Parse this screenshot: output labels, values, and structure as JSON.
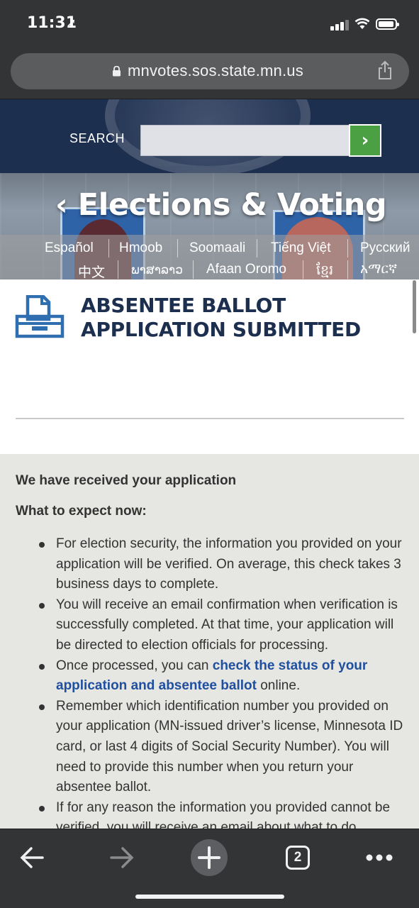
{
  "status_bar": {
    "time": "11:31",
    "location_glyph": "➚"
  },
  "browser": {
    "url": "mnvotes.sos.state.mn.us"
  },
  "header": {
    "search_label": "SEARCH",
    "search_placeholder": "",
    "search_go": "›"
  },
  "hero": {
    "title": "Elections & Voting",
    "back_glyph": "‹",
    "languages_row1": [
      "Español",
      "Hmoob",
      "Soomaali",
      "Tiếng Việt",
      "Русский"
    ],
    "languages_row2": [
      "中文",
      "ພາສາລາວ",
      "Afaan Oromo",
      "ខ្មែរ",
      "አማርኛ"
    ]
  },
  "main": {
    "title_line1": "ABSENTEE BALLOT",
    "title_line2": "APPLICATION SUBMITTED",
    "received": "We have received your application",
    "expect": "What to expect now:",
    "bullets": [
      "For election security, the information you provided on your application will be verified. On average, this check takes 3 business days to complete.",
      "You will receive an email confirmation when verification is successfully completed. At that time, your application will be directed to election officials for processing.",
      "Remember which identification number you provided on your application (MN-issued driver’s license, Minnesota ID card, or last 4 digits of Social Security Number). You will need to provide this number when you return your absentee ballot.",
      "If for any reason the information you provided cannot be verified, you will receive an email about what to do."
    ],
    "bullet3_before": "Once processed, you can ",
    "bullet3_link": "check the status of your application and absentee ballot",
    "bullet3_after": " online."
  },
  "toolbar": {
    "tab_count": "2"
  },
  "colors": {
    "navy": "#1c2f4f",
    "green": "#4aa043",
    "link": "#1f4f9e",
    "content_bg": "#e6e6e3"
  }
}
